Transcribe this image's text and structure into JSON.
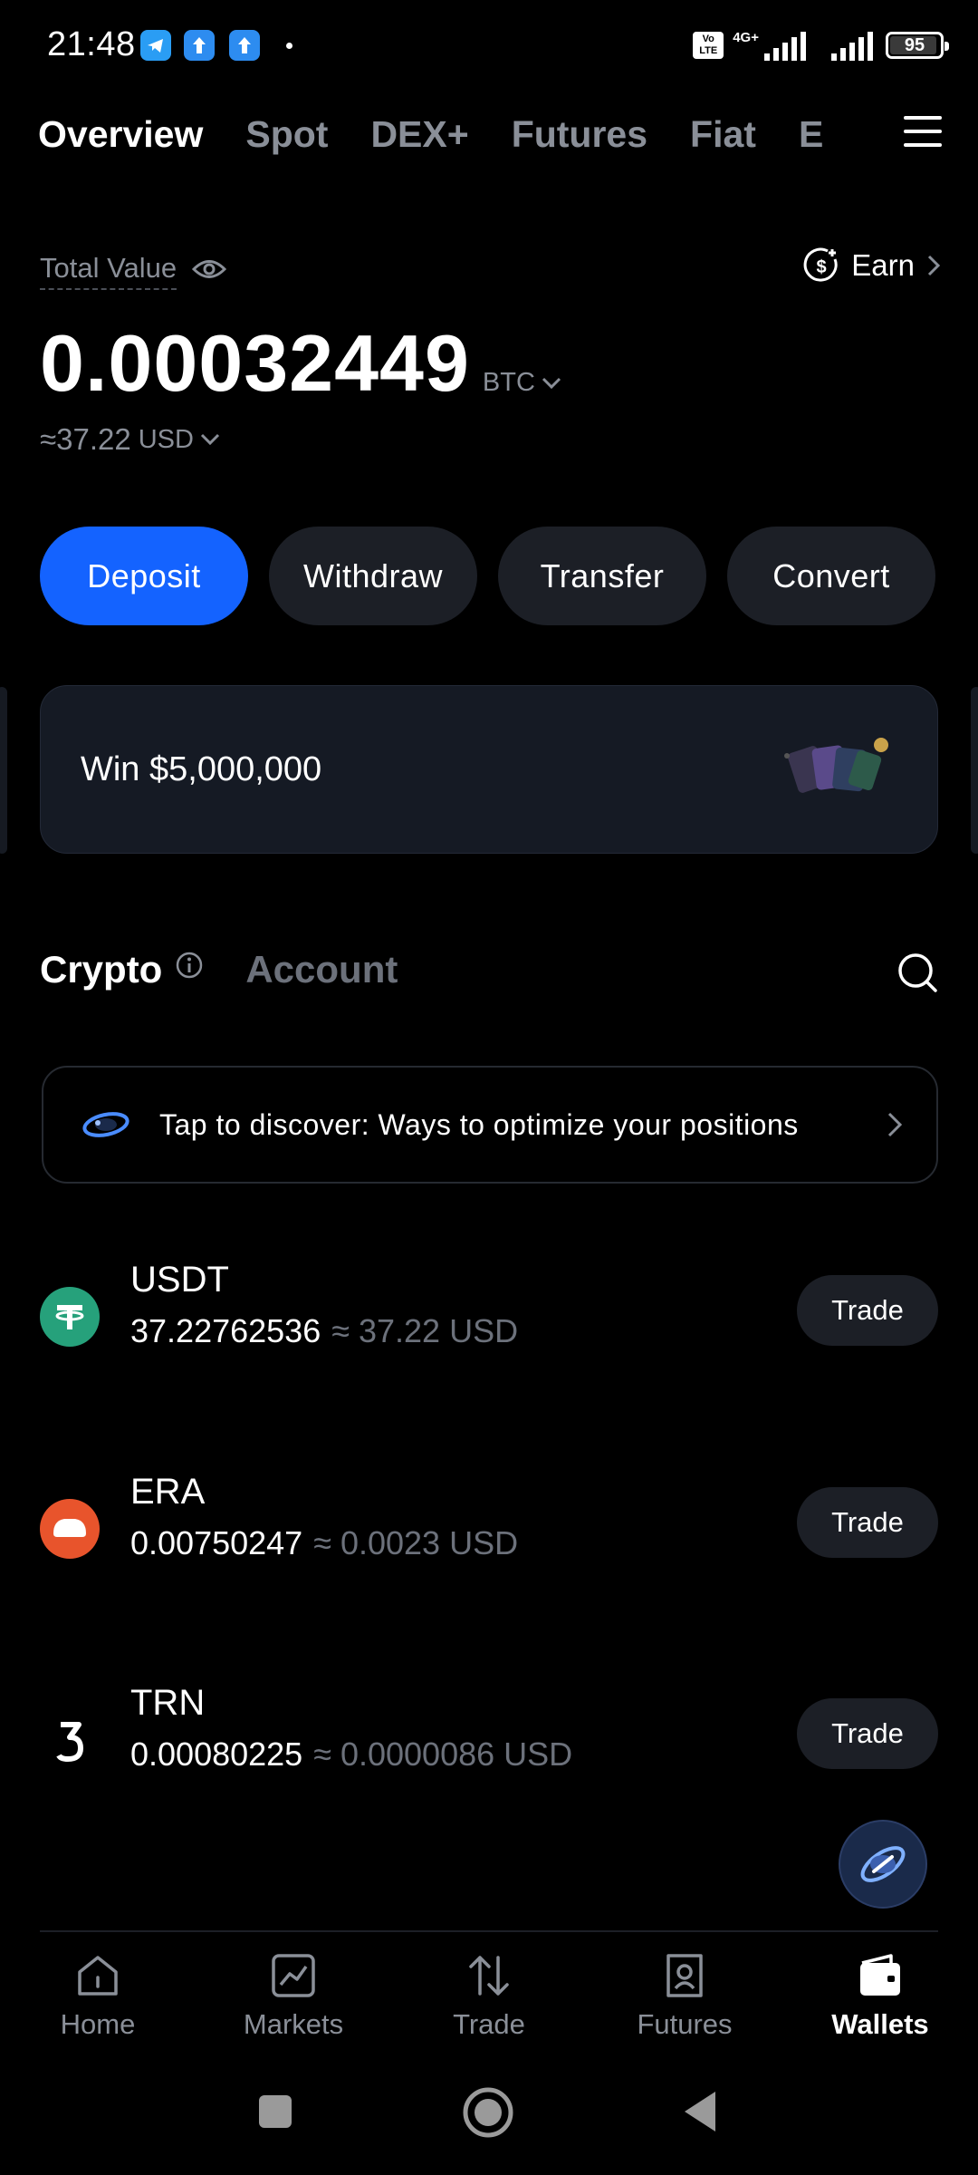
{
  "status_bar": {
    "time": "21:48",
    "network": "4G+",
    "volte": "Vo LTE",
    "battery": "95",
    "battery_level": 0.95
  },
  "top_tabs": [
    {
      "label": "Overview",
      "active": true
    },
    {
      "label": "Spot",
      "active": false
    },
    {
      "label": "DEX+",
      "active": false
    },
    {
      "label": "Futures",
      "active": false
    },
    {
      "label": "Fiat",
      "active": false
    },
    {
      "label": "E",
      "active": false
    }
  ],
  "overview": {
    "total_value_label": "Total Value",
    "earn_label": "Earn",
    "balance": "0.00032449",
    "balance_unit": "BTC",
    "approx_value": "≈37.22",
    "approx_unit": "USD"
  },
  "actions": [
    {
      "label": "Deposit",
      "primary": true
    },
    {
      "label": "Withdraw",
      "primary": false
    },
    {
      "label": "Transfer",
      "primary": false
    },
    {
      "label": "Convert",
      "primary": false
    }
  ],
  "banner": {
    "text": "Win $5,000,000"
  },
  "sub_tabs": [
    {
      "label": "Crypto",
      "active": true
    },
    {
      "label": "Account",
      "active": false
    }
  ],
  "discover": {
    "text": "Tap to discover: Ways to optimize your positions"
  },
  "assets": [
    {
      "symbol": "USDT",
      "amount": "37.22762536",
      "usd": "≈ 37.22 USD",
      "trade_label": "Trade",
      "icon": "usdt-icon",
      "color": "#26a17b"
    },
    {
      "symbol": "ERA",
      "amount": "0.00750247",
      "usd": "≈ 0.0023 USD",
      "trade_label": "Trade",
      "icon": "era-icon",
      "color": "#e8542c"
    },
    {
      "symbol": "TRN",
      "amount": "0.00080225",
      "usd": "≈ 0.0000086 USD",
      "trade_label": "Trade",
      "icon": "trn-icon",
      "color": "#000000"
    }
  ],
  "bottom_nav": [
    {
      "label": "Home",
      "icon": "home-icon",
      "active": false
    },
    {
      "label": "Markets",
      "icon": "markets-icon",
      "active": false
    },
    {
      "label": "Trade",
      "icon": "trade-icon",
      "active": false
    },
    {
      "label": "Futures",
      "icon": "futures-icon",
      "active": false
    },
    {
      "label": "Wallets",
      "icon": "wallet-icon",
      "active": true
    }
  ],
  "colors": {
    "accent": "#1463ff",
    "background": "#000000",
    "surface": "#1c1f26",
    "muted_text": "#8a8f98"
  }
}
